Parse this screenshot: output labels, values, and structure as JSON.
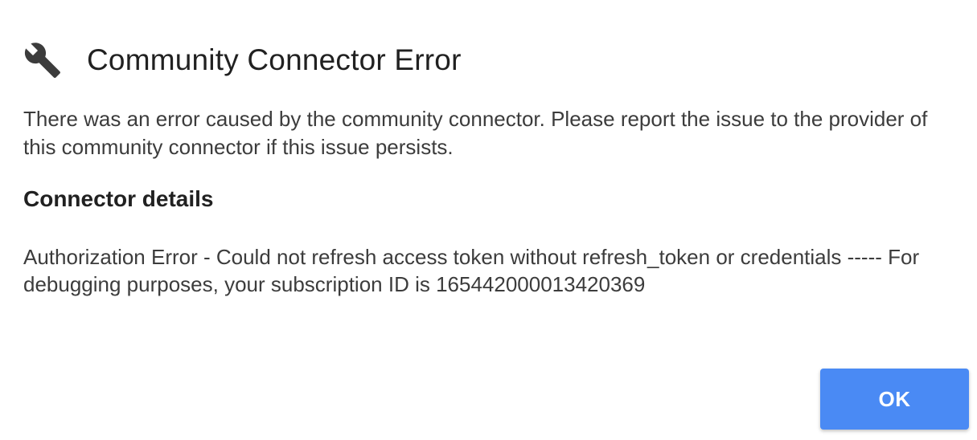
{
  "dialog": {
    "title": "Community Connector Error",
    "icon": "wrench-icon",
    "message": "There was an error caused by the community connector. Please report the issue to the provider of this community connector if this issue persists.",
    "details_heading": "Connector details",
    "details_text": "Authorization Error - Could not refresh access token without refresh_token or credentials ----- For debugging purposes, your subscription ID is 165442000013420369",
    "ok_label": "OK"
  },
  "colors": {
    "button_bg": "#4a8af4",
    "button_text": "#ffffff",
    "icon": "#3c3c3c",
    "title": "#212121"
  }
}
